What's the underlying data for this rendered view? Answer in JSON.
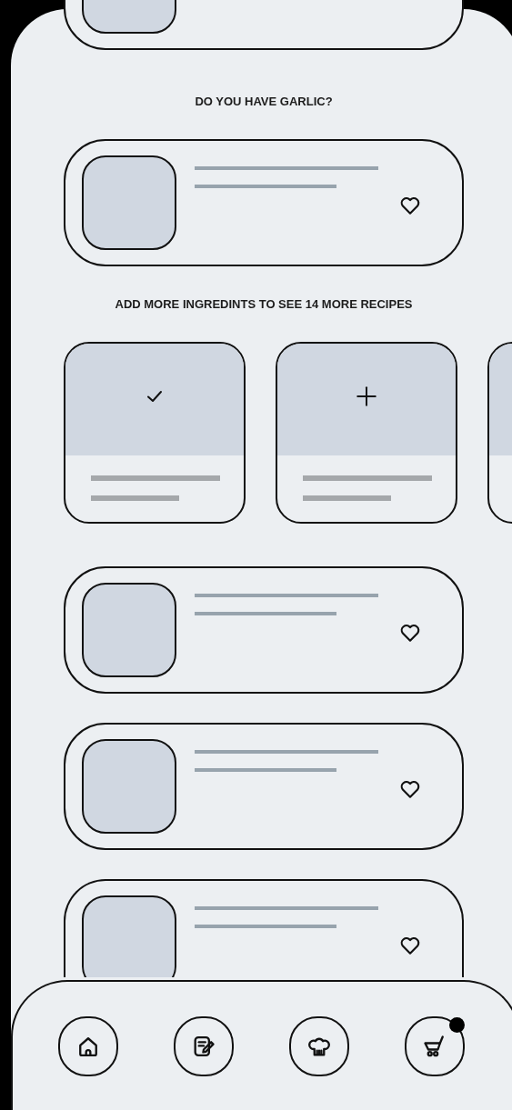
{
  "feed": [
    {
      "kind": "recipe_card"
    },
    {
      "kind": "heading",
      "text": "DO YOU HAVE GARLIC?"
    },
    {
      "kind": "recipe_card",
      "favorite": false
    },
    {
      "kind": "heading",
      "text": "ADD MORE INGREDINTS TO SEE 14 MORE RECIPES"
    },
    {
      "kind": "ingredients",
      "cards": [
        {
          "kind": "ingredient",
          "checked": true
        },
        {
          "kind": "ingredient",
          "checked": false
        },
        {
          "kind": "cut_off"
        }
      ]
    },
    {
      "kind": "recipe_card",
      "favorite": false
    },
    {
      "kind": "recipe_card",
      "favorite": false
    },
    {
      "kind": "recipe_card",
      "favorite": false
    }
  ],
  "nav": [
    {
      "kind": "home",
      "badge": false
    },
    {
      "kind": "notes",
      "badge": false
    },
    {
      "kind": "chef",
      "badge": false
    },
    {
      "kind": "cart",
      "badge": true
    }
  ]
}
